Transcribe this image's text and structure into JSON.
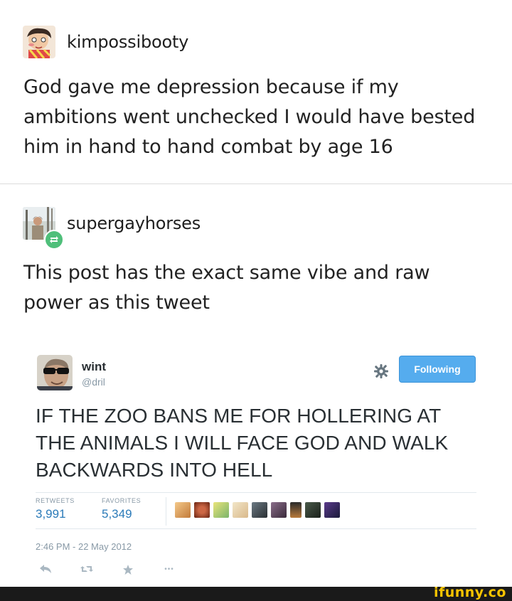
{
  "post1": {
    "username": "kimpossibooty",
    "body": "God gave me depression because if my ambitions went unchecked I would have bested him in hand to hand combat by age 16"
  },
  "post2": {
    "username": "supergayhorses",
    "body": "This post has the exact same vibe and raw power as this tweet"
  },
  "tweet": {
    "name": "wint",
    "handle": "@dril",
    "follow_label": "Following",
    "text": "IF THE ZOO BANS ME FOR HOLLERING AT THE ANIMALS I WILL FACE GOD AND WALK BACKWARDS INTO HELL",
    "retweets_label": "RETWEETS",
    "retweets_value": "3,991",
    "favorites_label": "FAVORITES",
    "favorites_value": "5,349",
    "timestamp": "2:46 PM - 22 May 2012",
    "more_glyph": "•••"
  },
  "watermark": "ifunny.co",
  "colors": {
    "follow_button": "#55acee",
    "stat_value": "#2b7bb9",
    "reblog_badge": "#4fbf7a",
    "watermark": "#f7c400"
  }
}
